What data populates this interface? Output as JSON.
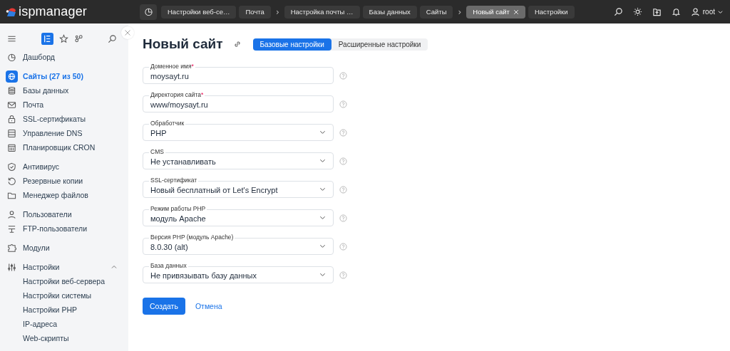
{
  "header": {
    "logo": "ispmanager",
    "tabs": [
      {
        "kind": "tab",
        "label": "Настройки веб-се…",
        "selected": false
      },
      {
        "kind": "tab",
        "label": "Почта",
        "selected": false
      },
      {
        "kind": "separator",
        "label": "›"
      },
      {
        "kind": "tab",
        "label": "Настройка почты …",
        "selected": false
      },
      {
        "kind": "tab",
        "label": "Базы данных",
        "selected": false
      },
      {
        "kind": "tab",
        "label": "Сайты",
        "selected": false
      },
      {
        "kind": "separator",
        "label": "›"
      },
      {
        "kind": "tab",
        "label": "Новый сайт",
        "selected": true
      },
      {
        "kind": "tab",
        "label": "Настройки",
        "selected": false
      }
    ],
    "user": "root"
  },
  "sidebar": {
    "groups": [
      [
        {
          "label": "Дашборд",
          "selected": false
        }
      ],
      [
        {
          "label": "Сайты (27 из 50)",
          "selected": true
        },
        {
          "label": "Базы данных",
          "selected": false
        },
        {
          "label": "Почта",
          "selected": false
        },
        {
          "label": "SSL-сертификаты",
          "selected": false
        },
        {
          "label": "Управление DNS",
          "selected": false
        },
        {
          "label": "Планировщик CRON",
          "selected": false
        }
      ],
      [
        {
          "label": "Антивирус",
          "selected": false
        },
        {
          "label": "Резервные копии",
          "selected": false
        },
        {
          "label": "Менеджер файлов",
          "selected": false
        }
      ],
      [
        {
          "label": "Пользователи",
          "selected": false
        },
        {
          "label": "FTP-пользователи",
          "selected": false
        }
      ],
      [
        {
          "label": "Модули",
          "selected": false
        }
      ],
      [
        {
          "label": "Настройки",
          "selected": false,
          "expanded": true,
          "children": [
            {
              "label": "Настройки веб-сервера",
              "selected": false
            },
            {
              "label": "Настройки системы",
              "selected": false
            },
            {
              "label": "Настройки PHP",
              "selected": false
            },
            {
              "label": "IP-адреса",
              "selected": false
            },
            {
              "label": "Web-скрипты",
              "selected": false
            }
          ]
        }
      ]
    ]
  },
  "page": {
    "title": "Новый сайт",
    "tabs": [
      {
        "label": "Базовые настройки",
        "selected": true
      },
      {
        "label": "Расширенные настройки",
        "selected": false
      }
    ],
    "fields": [
      {
        "kind": "input",
        "label": "Доменное имя",
        "required_mark": "*",
        "value": "moysayt.ru"
      },
      {
        "kind": "input",
        "label": "Директория сайта",
        "required_mark": "*",
        "value": "www/moysayt.ru"
      },
      {
        "kind": "select",
        "label": "Обработчик",
        "value": "PHP"
      },
      {
        "kind": "select",
        "label": "CMS",
        "value": "Не устанавливать"
      },
      {
        "kind": "select",
        "label": "SSL-сертификат",
        "value": "Новый бесплатный от Let's Encrypt"
      },
      {
        "kind": "select",
        "label": "Режим работы PHP",
        "value": "модуль Apache"
      },
      {
        "kind": "select",
        "label": "Версия PHP (модуль Apache)",
        "value": "8.0.30 (alt)"
      },
      {
        "kind": "select",
        "label": "База данных",
        "value": "Не привязывать базу данных"
      }
    ],
    "buttons": [
      {
        "kind": "primary",
        "label": "Создать"
      },
      {
        "kind": "link",
        "label": "Отмена"
      }
    ]
  }
}
